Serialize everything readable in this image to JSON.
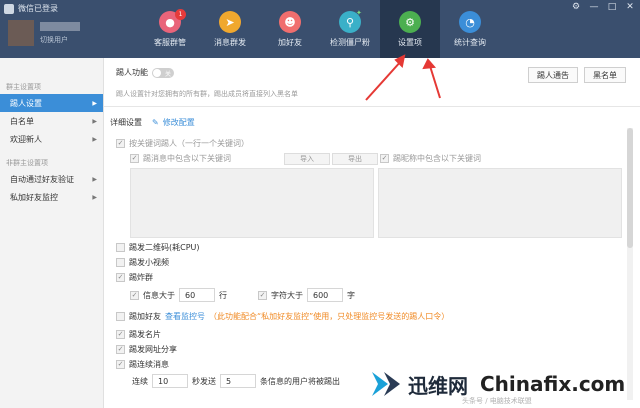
{
  "window": {
    "title": "微信已登录",
    "user_status": "切换用户",
    "controls": [
      "⚙",
      "—",
      "□",
      "✕"
    ]
  },
  "nav": {
    "items": [
      {
        "label": "客服群管",
        "icon": "group-icon",
        "color": "#e9647a",
        "badge": "1"
      },
      {
        "label": "消息群发",
        "icon": "send-icon",
        "color": "#f0a82e"
      },
      {
        "label": "加好友",
        "icon": "add-friend-icon",
        "color": "#f06e6e"
      },
      {
        "label": "检测僵尸粉",
        "icon": "detect-icon",
        "color": "#3ab0c8"
      },
      {
        "label": "设置项",
        "icon": "gear-icon",
        "color": "#4caf50",
        "active": true
      },
      {
        "label": "统计查询",
        "icon": "chart-icon",
        "color": "#3b8ed8"
      }
    ]
  },
  "sidebar": {
    "group1": "群主设置项",
    "items1": [
      "踢人设置",
      "白名单",
      "欢迎新人"
    ],
    "group2": "非群主设置项",
    "items2": [
      "自动通过好友验证",
      "私加好友监控"
    ]
  },
  "main": {
    "feature_label": "踢人功能",
    "toggle_text": "关",
    "hint": "踢人设置针对您拥有的所有群，踢出成员将直接列入黑名单",
    "btn_notice": "踢人通告",
    "btn_blacklist": "黑名单",
    "detail_label": "详细设置",
    "edit_label": "修改配置",
    "keyword_kick": "按关键词踢人（一行一个关键词）",
    "msg_contains": "踢消息中包含以下关键词",
    "btn_import": "导入",
    "btn_export": "导出",
    "nick_contains": "踢昵称中包含以下关键词",
    "qrcode": "踢发二维码(耗CPU)",
    "video": "踢发小视频",
    "spam": "踢炸群",
    "msg_gt": "信息大于",
    "msg_gt_val": "60",
    "row_unit": "行",
    "char_gt": "字符大于",
    "char_gt_val": "600",
    "char_unit": "字",
    "private_add": "踢加好友",
    "private_link": "查看监控号",
    "private_warn": "（此功能配合“私加好友监控”使用，只处理监控号发送的踢人口令）",
    "card": "踢发名片",
    "url_share": "踢发网址分享",
    "continuous": "踢连续消息",
    "cont_prefix": "连续",
    "cont_sec": "10",
    "cont_mid": "秒发送",
    "cont_count": "5",
    "cont_suffix": "条信息的用户将被踢出"
  },
  "watermark": {
    "brand_cn": "迅维网",
    "brand_en": "Chinafix.com",
    "sub": "头条号 / 电脑技术联盟"
  },
  "colors": {
    "header": "#3a4f6e",
    "accent": "#3b8ed8",
    "arrow": "#e53935"
  }
}
